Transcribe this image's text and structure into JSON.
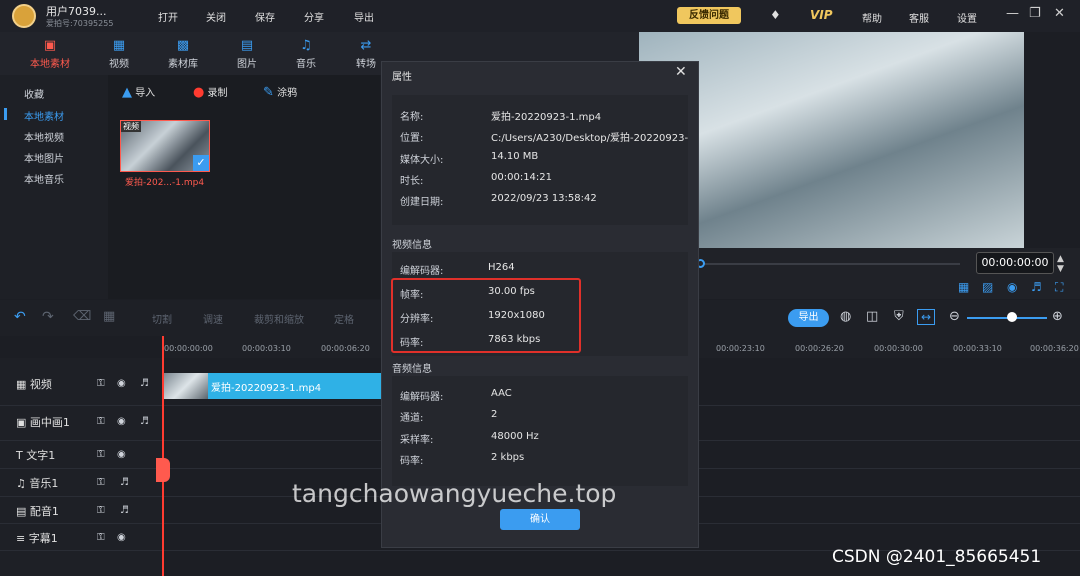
{
  "user": {
    "name": "用户7039...",
    "id": "爱拍号:70395255"
  },
  "menu": [
    "打开",
    "关闭",
    "保存",
    "分享",
    "导出"
  ],
  "titlebar": {
    "feedback": "反馈问题",
    "vip": "VIP",
    "help": "帮助",
    "service": "客服",
    "settings": "设置"
  },
  "toolbar": [
    {
      "label": "本地素材",
      "icon": "box-icon",
      "active": true
    },
    {
      "label": "视频",
      "icon": "film-icon"
    },
    {
      "label": "素材库",
      "icon": "library-icon"
    },
    {
      "label": "图片",
      "icon": "image-icon"
    },
    {
      "label": "音乐",
      "icon": "music-icon"
    },
    {
      "label": "转场",
      "icon": "transition-icon"
    }
  ],
  "sidebar": [
    "收藏",
    "本地素材",
    "本地视频",
    "本地图片",
    "本地音乐"
  ],
  "media_actions": [
    "导入",
    "录制",
    "涂鸦"
  ],
  "thumb": {
    "badge": "视频",
    "name": "爱拍-202...-1.mp4"
  },
  "preview": {
    "timecode": "00:00:00:00"
  },
  "edit_tools": [
    "切割",
    "调速",
    "裁剪和缩放",
    "定格"
  ],
  "export": "导出",
  "ruler": [
    "00:00:00:00",
    "00:00:03:10",
    "00:00:06:20",
    "00:00:23:10",
    "00:00:26:20",
    "00:00:30:00",
    "00:00:33:10",
    "00:00:36:20"
  ],
  "tracks": [
    "视频",
    "画中画1",
    "文字1",
    "音乐1",
    "配音1",
    "字幕1"
  ],
  "clip": {
    "name": "爱拍-20220923-1.mp4"
  },
  "dialog": {
    "title": "属性",
    "basic": [
      [
        "名称:",
        "爱拍-20220923-1.mp4"
      ],
      [
        "位置:",
        "C:/Users/A230/Desktop/爱拍-20220923-"
      ],
      [
        "媒体大小:",
        "14.10 MB"
      ],
      [
        "时长:",
        "00:00:14:21"
      ],
      [
        "创建日期:",
        "2022/09/23 13:58:42"
      ]
    ],
    "video_title": "视频信息",
    "video": [
      [
        "编解码器:",
        "H264"
      ],
      [
        "帧率:",
        "30.00 fps"
      ],
      [
        "分辨率:",
        "1920x1080"
      ],
      [
        "码率:",
        "7863 kbps"
      ]
    ],
    "audio_title": "音频信息",
    "audio": [
      [
        "编解码器:",
        "AAC"
      ],
      [
        "通道:",
        "2"
      ],
      [
        "采样率:",
        "48000 Hz"
      ],
      [
        "码率:",
        "2 kbps"
      ]
    ],
    "confirm": "确认"
  },
  "watermark": "tangchaowangyueche.top",
  "csdn": "CSDN @2401_85665451"
}
